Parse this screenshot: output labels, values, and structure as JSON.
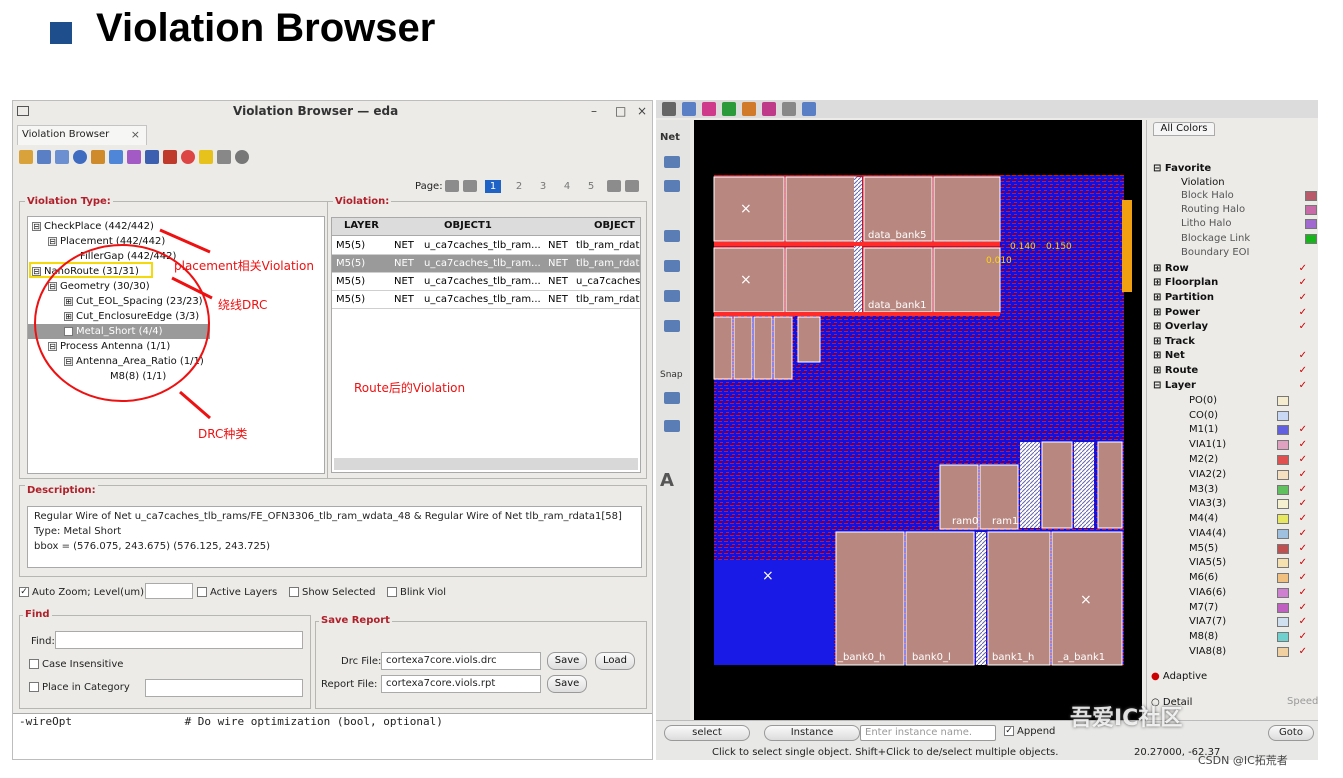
{
  "slide": {
    "title": "Violation Browser"
  },
  "browser": {
    "window_title": "Violation Browser — eda",
    "minimize": "–",
    "restore": "□",
    "close": "×",
    "tab_label": "Violation Browser",
    "tab_close": "×",
    "violation_type_label": "Violation Type:",
    "violation_label": "Violation:",
    "page_label": "Page:",
    "pages": [
      "1",
      "2",
      "3",
      "4",
      "5"
    ],
    "tree": [
      {
        "text": "CheckPlace (442/442)",
        "exp": "⊟"
      },
      {
        "text": "Placement (442/442)",
        "exp": "⊟"
      },
      {
        "text": "FillerGap (442/442)",
        "exp": ""
      },
      {
        "text": "NanoRoute (31/31)",
        "exp": "⊟"
      },
      {
        "text": "Geometry (30/30)",
        "exp": "⊟"
      },
      {
        "text": "Cut_EOL_Spacing (23/23)",
        "exp": "⊞"
      },
      {
        "text": "Cut_EnclosureEdge (3/3)",
        "exp": "⊞"
      },
      {
        "text": "Metal_Short (4/4)",
        "exp": "⊞"
      },
      {
        "text": "Process Antenna (1/1)",
        "exp": "⊟"
      },
      {
        "text": "Antenna_Area_Ratio (1/1)",
        "exp": "⊟"
      },
      {
        "text": "M8(8) (1/1)",
        "exp": ""
      }
    ],
    "table": {
      "headers": [
        "LAYER",
        "OBJECT1",
        "OBJECT"
      ],
      "rows": [
        [
          "M5(5)",
          "NET",
          "u_ca7caches_tlb_ram...",
          "NET",
          "tlb_ram_rdat"
        ],
        [
          "M5(5)",
          "NET",
          "u_ca7caches_tlb_ram...",
          "NET",
          "tlb_ram_rdat"
        ],
        [
          "M5(5)",
          "NET",
          "u_ca7caches_tlb_ram...",
          "NET",
          "u_ca7caches"
        ],
        [
          "M5(5)",
          "NET",
          "u_ca7caches_tlb_ram...",
          "NET",
          "tlb_ram_rdat"
        ]
      ]
    },
    "description_label": "Description:",
    "description": [
      "Regular Wire of Net u_ca7caches_tlb_rams/FE_OFN3306_tlb_ram_wdata_48 & Regular Wire of Net tlb_ram_rdata1[58]",
      "Type:            Metal Short",
      "bbox = (576.075, 243.675) (576.125, 243.725)"
    ],
    "options": {
      "auto_zoom": "Auto Zoom;  Level(um)",
      "active_layers": "Active Layers",
      "show_selected": "Show Selected",
      "blink_viol": "Blink Viol"
    },
    "find": {
      "label": "Find",
      "find_field": "Find:",
      "case_insensitive": "Case Insensitive",
      "place_in_category": "Place in Category"
    },
    "save_report": {
      "label": "Save Report",
      "drc_file_label": "Drc File:",
      "drc_file_value": "cortexa7core.viols.drc",
      "report_file_label": "Report File:",
      "report_file_value": "cortexa7core.viols.rpt",
      "save": "Save",
      "load": "Load"
    },
    "console_text": "-wireOpt                 # Do wire optimization (bool, optional)"
  },
  "annotations": {
    "placement": "placement相关Violation",
    "route_drc": "绕线DRC",
    "route_violation": "Route后的Violation",
    "drc_kind": "DRC种类"
  },
  "layout": {
    "net_label": "Net",
    "snap_label": "Snap",
    "all_colors": "All Colors",
    "canvas_labels": [
      "data_bank5",
      "data_bank1",
      "ram0",
      "ram1",
      "_bank0_h",
      "bank0_l",
      "bank1_h",
      "_a_bank1"
    ],
    "coord_labels": [
      "0.140",
      "0.150",
      "0.010"
    ],
    "favorite": "Favorite",
    "favorite_items": [
      "Violation",
      "Block Halo",
      "Routing Halo",
      "Litho Halo",
      "Blockage Link",
      "Boundary EOI"
    ],
    "categories": [
      "Row",
      "Floorplan",
      "Partition",
      "Power",
      "Overlay",
      "Track",
      "Net",
      "Route",
      "Layer"
    ],
    "layers": [
      "PO(0)",
      "CO(0)",
      "M1(1)",
      "VIA1(1)",
      "M2(2)",
      "VIA2(2)",
      "M3(3)",
      "VIA3(3)",
      "M4(4)",
      "VIA4(4)",
      "M5(5)",
      "VIA5(5)",
      "M6(6)",
      "VIA6(6)",
      "M7(7)",
      "VIA7(7)",
      "M8(8)",
      "VIA8(8)"
    ],
    "adaptive": "Adaptive",
    "detail": "Detail",
    "speed": "Speed",
    "select": "select",
    "instance": "Instance",
    "instance_placeholder": "Enter instance name.",
    "append": "Append",
    "goto": "Goto",
    "status_text": "Click to select single object. Shift+Click to de/select multiple objects.",
    "coords": "20.27000, -62.37"
  },
  "watermark": "吾爱IC社区",
  "footer": "CSDN @IC拓荒者"
}
